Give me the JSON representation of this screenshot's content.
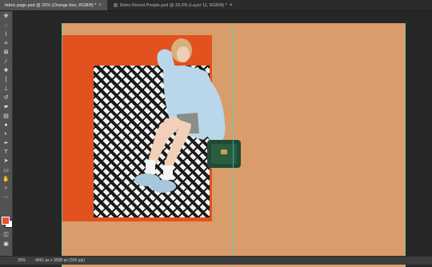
{
  "tabs": [
    {
      "label": "fabric page.psd @ 25% (Orange box, RGB/8) *",
      "active": true
    },
    {
      "label": "Retro Resort People.psd @ 33.3% (Layer 11, RGB/8) *",
      "active": false
    }
  ],
  "tools": [
    "move-icon",
    "lasso-icon",
    "quick-select-icon",
    "crop-icon",
    "frame-icon",
    "eyedropper-icon",
    "healing-icon",
    "brush-icon",
    "stamp-icon",
    "history-brush-icon",
    "eraser-icon",
    "gradient-icon",
    "blur-icon",
    "dodge-icon",
    "pen-icon",
    "type-icon",
    "path-select-icon",
    "rectangle-icon",
    "hand-icon",
    "zoom-icon",
    "more-icon"
  ],
  "colors": {
    "foreground": "#e8512a",
    "background": "#ffffff",
    "canvas": "#d99d6b",
    "orange_box": "#e2521e"
  },
  "status": {
    "zoom": "25%",
    "doc_info": "4961 px x 3508 px (300 ppi)"
  }
}
